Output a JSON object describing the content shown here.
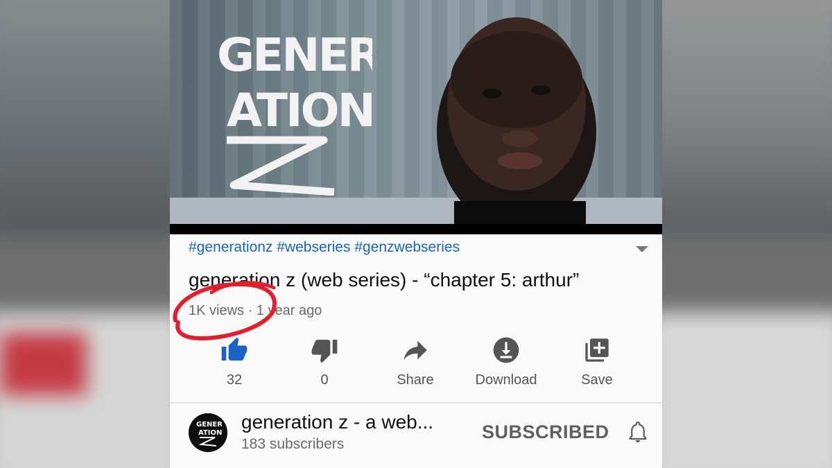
{
  "video": {
    "hashtags": "#generationz #webseries #genzwebseries",
    "title": "generation z (web series) - “chapter 5: arthur”",
    "meta": "1K views · 1 year ago",
    "thumbnail_logo": "GENER ATION Z"
  },
  "actions": [
    {
      "icon": "thumbs-up-icon",
      "label": "32",
      "active": true
    },
    {
      "icon": "thumbs-down-icon",
      "label": "0",
      "active": false
    },
    {
      "icon": "share-icon",
      "label": "Share",
      "active": false
    },
    {
      "icon": "download-icon",
      "label": "Download",
      "active": false
    },
    {
      "icon": "save-playlist-icon",
      "label": "Save",
      "active": false
    }
  ],
  "channel": {
    "name": "generation z - a web...",
    "subscribers": "183 subscribers",
    "subscribe_state": "SUBSCRIBED",
    "avatar_text": "GENER ATION Z"
  },
  "colors": {
    "accent": "#1a63c4",
    "annotation": "#e0202f",
    "text_primary": "#111111",
    "text_secondary": "#6a6a6a"
  }
}
